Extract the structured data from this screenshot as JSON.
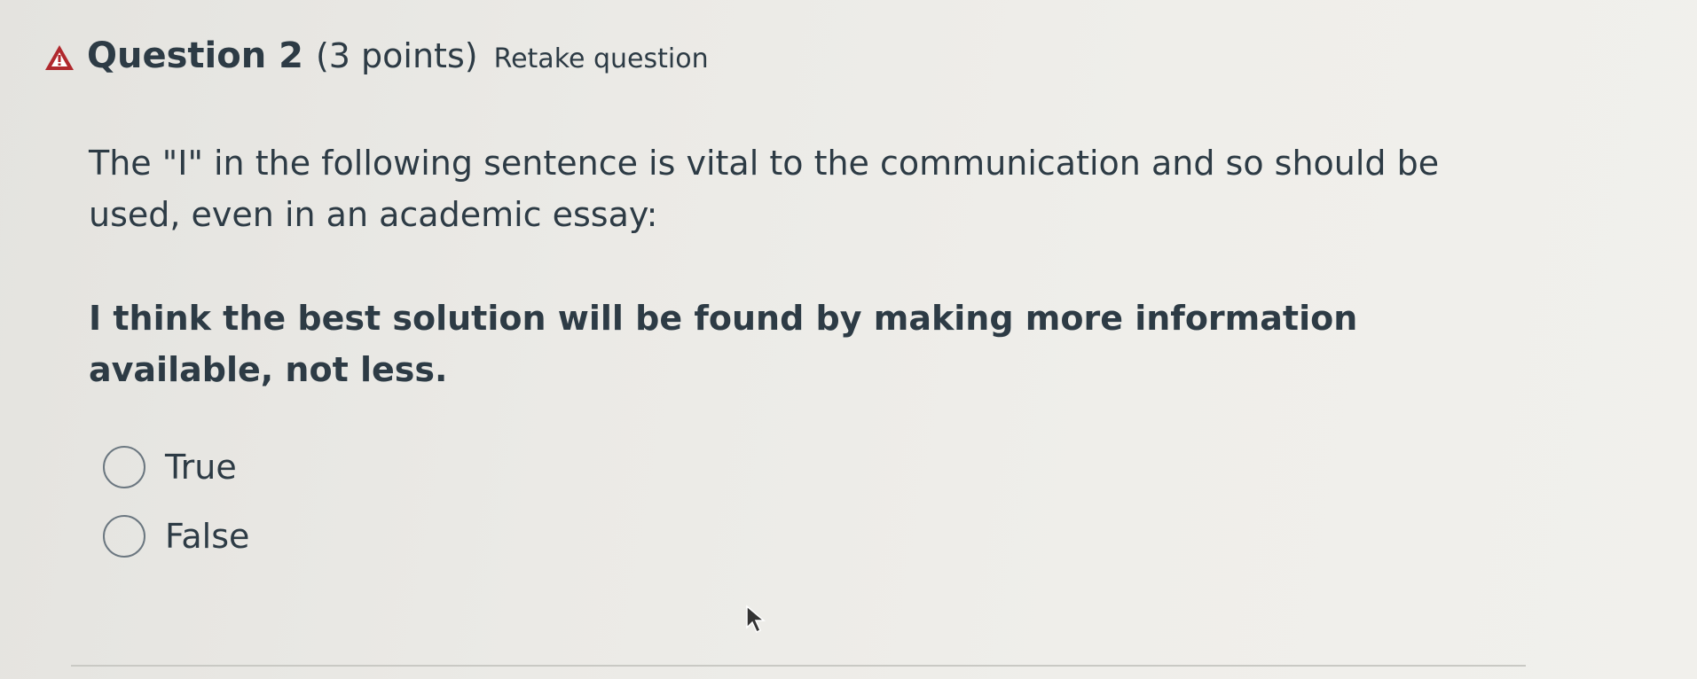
{
  "question": {
    "title": "Question 2",
    "points": "(3 points)",
    "retake_label": "Retake question",
    "warning_icon": "warning-triangle-icon",
    "warning_color": "#b0282d",
    "text": "The \"I\" in the following sentence is vital to the communication and so should be used, even in an academic essay:",
    "quote": "I think the best solution will be found by making more information available, not less."
  },
  "answers": [
    {
      "label": "True",
      "selected": false
    },
    {
      "label": "False",
      "selected": false
    }
  ],
  "colors": {
    "text": "#2d3b45",
    "radio_border": "#6b7780",
    "background": "#ebeae6"
  }
}
